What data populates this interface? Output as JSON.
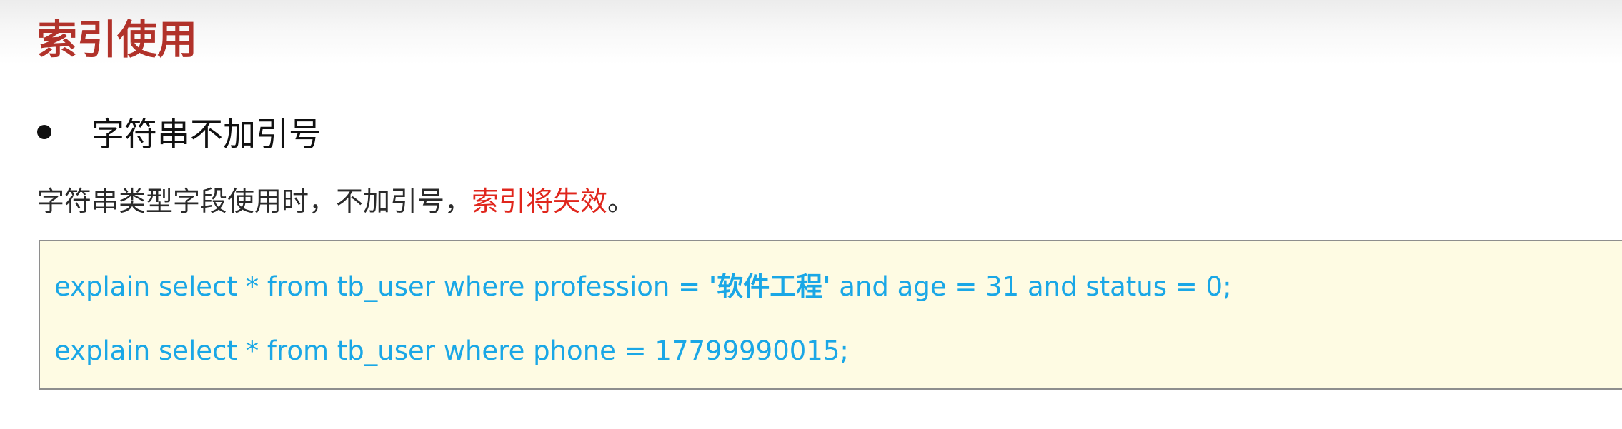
{
  "title": "索引使用",
  "bullet": {
    "text": "字符串不加引号"
  },
  "description": {
    "text": "字符串类型字段使用时，不加引号，",
    "warning": "索引将失效",
    "end": "。"
  },
  "code": {
    "line1": {
      "prefix": "explain select * from tb_user where profession = ",
      "quoted": "'软件工程'",
      "suffix": " and age = 31 and status = 0;"
    },
    "line2": "explain select * from tb_user where phone = 17799990015;"
  },
  "colors": {
    "title": "#b1322a",
    "warning": "#e0261c",
    "code_text": "#1aa7e6",
    "code_background": "#fefbe3"
  }
}
